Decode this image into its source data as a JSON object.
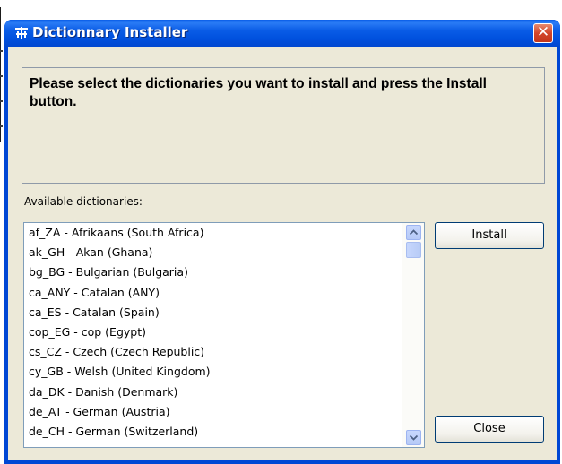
{
  "window": {
    "title": "Dictionnary Installer",
    "title_icon": "app-icon",
    "close_glyph": "✕"
  },
  "instructions": {
    "text": "Please select the dictionaries you want to install and press the Install button."
  },
  "available_label": "Available dictionaries:",
  "dictionaries": [
    "af_ZA - Afrikaans (South Africa)",
    "ak_GH - Akan (Ghana)",
    "bg_BG - Bulgarian (Bulgaria)",
    "ca_ANY - Catalan (ANY)",
    "ca_ES - Catalan (Spain)",
    "cop_EG - cop (Egypt)",
    "cs_CZ - Czech (Czech Republic)",
    "cy_GB - Welsh (United Kingdom)",
    "da_DK - Danish (Denmark)",
    "de_AT - German (Austria)",
    "de_CH - German (Switzerland)"
  ],
  "buttons": {
    "install": "Install",
    "close": "Close"
  },
  "colors": {
    "titlebar": "#0a5ce6",
    "client": "#ece9d8",
    "close_button": "#d2452a"
  }
}
